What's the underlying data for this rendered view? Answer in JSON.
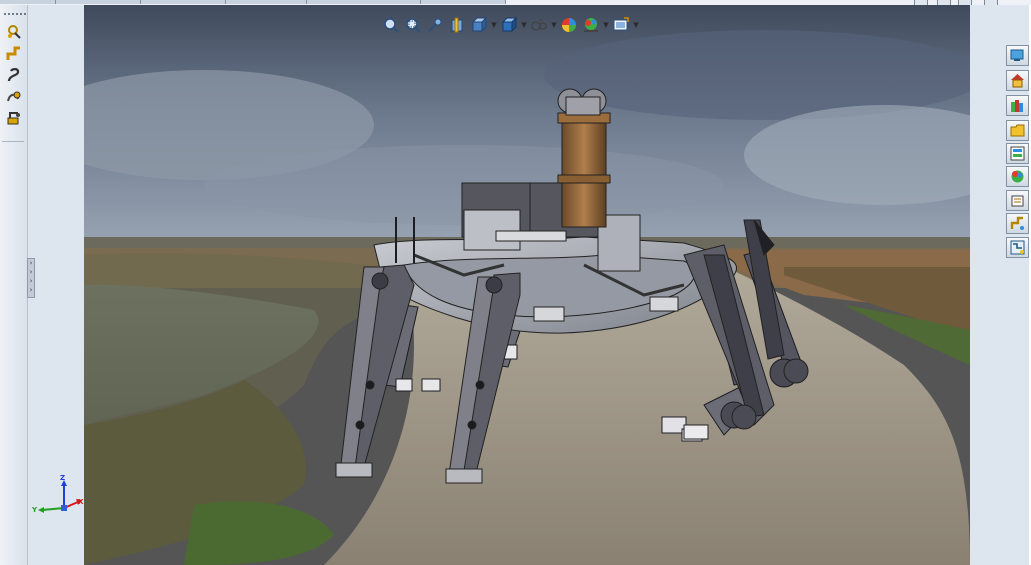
{
  "window": {
    "controls": [
      "minimize-icon",
      "restore-icon",
      "maximize-icon",
      "close-icon"
    ]
  },
  "left_toolbar": {
    "items": [
      {
        "icon": "sketch-dimension-icon"
      },
      {
        "icon": "route-pipe-icon"
      },
      {
        "icon": "spline-route-icon"
      },
      {
        "icon": "route-options-icon"
      },
      {
        "icon": "route-properties-icon"
      }
    ]
  },
  "heads_up_toolbar": {
    "items": [
      {
        "icon": "zoom-to-fit-icon",
        "dropdown": false
      },
      {
        "icon": "zoom-to-area-icon",
        "dropdown": false
      },
      {
        "icon": "previous-view-icon",
        "dropdown": false
      },
      {
        "icon": "section-view-icon",
        "dropdown": false
      },
      {
        "icon": "view-orientation-icon",
        "dropdown": true
      },
      {
        "icon": "display-style-icon",
        "dropdown": true
      },
      {
        "icon": "hide-show-items-icon",
        "dropdown": true
      },
      {
        "icon": "edit-appearance-icon",
        "dropdown": false
      },
      {
        "icon": "apply-scene-icon",
        "dropdown": true
      },
      {
        "icon": "view-settings-icon",
        "dropdown": true
      }
    ]
  },
  "task_pane": {
    "items": [
      {
        "icon": "resources-icon"
      },
      {
        "icon": "home-icon"
      },
      {
        "icon": "design-library-icon"
      },
      {
        "icon": "file-explorer-icon"
      },
      {
        "icon": "view-palette-icon"
      },
      {
        "icon": "appearances-scenes-icon"
      },
      {
        "icon": "custom-properties-icon"
      },
      {
        "icon": "routing-library-icon"
      },
      {
        "icon": "forum-icon"
      }
    ]
  },
  "triad": {
    "x_label": "X",
    "y_label": "Y",
    "z_label": "Z"
  },
  "colors": {
    "x_axis": "#d11a1a",
    "y_axis": "#1fa11f",
    "z_axis": "#1f3fd6",
    "sky": "#5b6a80",
    "ground": "#8c8478"
  }
}
